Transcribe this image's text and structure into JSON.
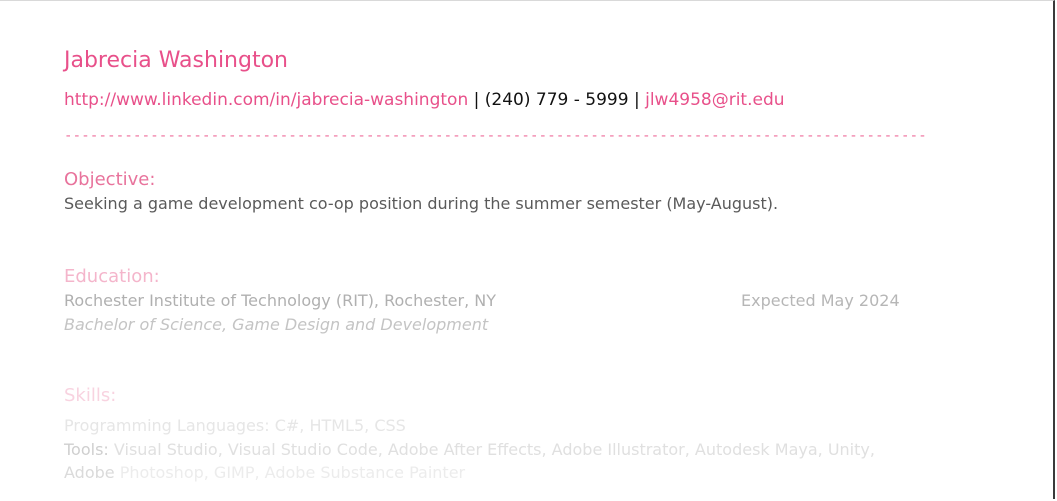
{
  "resume": {
    "name": "Jabrecia Washington",
    "contact": {
      "linkedin": "http://www.linkedin.com/in/jabrecia-washington",
      "sep1": " | ",
      "phone": "(240) 779 - 5999",
      "sep2": " | ",
      "email": "jlw4958@rit.edu"
    },
    "divider": "----------------------------------------------------------------------------------------------------",
    "objective": {
      "heading": "Objective:",
      "text": "Seeking a game development co-op position during the summer semester (May-August)."
    },
    "education": {
      "heading": "Education:",
      "school": "Rochester Institute of Technology (RIT), Rochester, NY",
      "date": "Expected May 2024",
      "degree": "Bachelor of Science, Game Design and Development"
    },
    "skills": {
      "heading": "Skills:",
      "languages_label": "Programming Languages:",
      "languages": " C#, HTML5, CSS",
      "tools_label": "Tools:",
      "tools": " Visual Studio, Visual Studio Code, Adobe After Effects, Adobe Illustrator, Autodesk Maya, Unity,",
      "tools_cont_label": "Adobe",
      "tools_cont": " Photoshop, GIMP, Adobe Substance Painter"
    }
  },
  "colors": {
    "accent": "#e8508a",
    "text": "#5a5a5a"
  }
}
